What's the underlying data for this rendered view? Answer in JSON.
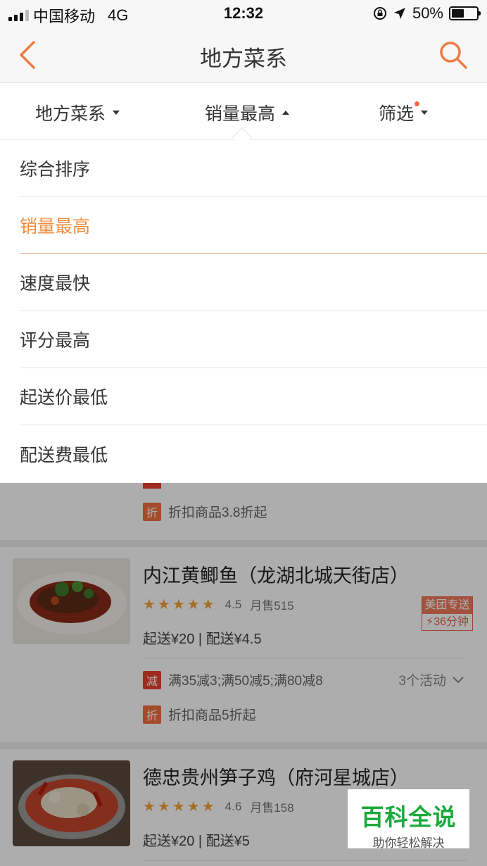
{
  "status_bar": {
    "carrier": "中国移动",
    "network": "4G",
    "time": "12:32",
    "battery": "50%",
    "battery_level": 0.5
  },
  "nav": {
    "title": "地方菜系"
  },
  "filters": [
    {
      "label": "地方菜系"
    },
    {
      "label": "销量最高"
    },
    {
      "label": "筛选"
    }
  ],
  "sort_options": [
    {
      "label": "综合排序"
    },
    {
      "label": "销量最高"
    },
    {
      "label": "速度最快"
    },
    {
      "label": "评分最高"
    },
    {
      "label": "起送价最低"
    },
    {
      "label": "配送费最低"
    }
  ],
  "list": {
    "prev_shop_promo": {
      "tag": "折",
      "text": "折扣商品3.8折起"
    },
    "shops": [
      {
        "name": "内江黄鲫鱼（龙湖北城天街店）",
        "stars": "★★★★★",
        "rating": "4.5",
        "monthly_sales": "月售515",
        "delivery": "起送¥20 | 配送¥4.5",
        "badge_top": "美团专送",
        "badge_bottom": "⚡36分钟",
        "promos": [
          {
            "tag": "减",
            "text": "满35减3;满50减5;满80减8"
          },
          {
            "tag": "折",
            "text": "折扣商品5折起"
          }
        ],
        "more_activities": "3个活动"
      },
      {
        "name": "德忠贵州笋子鸡（府河星城店）",
        "stars": "★★★★★",
        "rating": "4.6",
        "monthly_sales": "月售158",
        "delivery": "起送¥20 | 配送¥5"
      }
    ]
  },
  "watermark": {
    "title": "百科全说",
    "subtitle": "助你轻松解决"
  },
  "colors": {
    "accent": "#ef8c3d",
    "star": "#f3a23a",
    "tag_red": "#e8422f",
    "watermark_green": "#1aaa3a"
  }
}
